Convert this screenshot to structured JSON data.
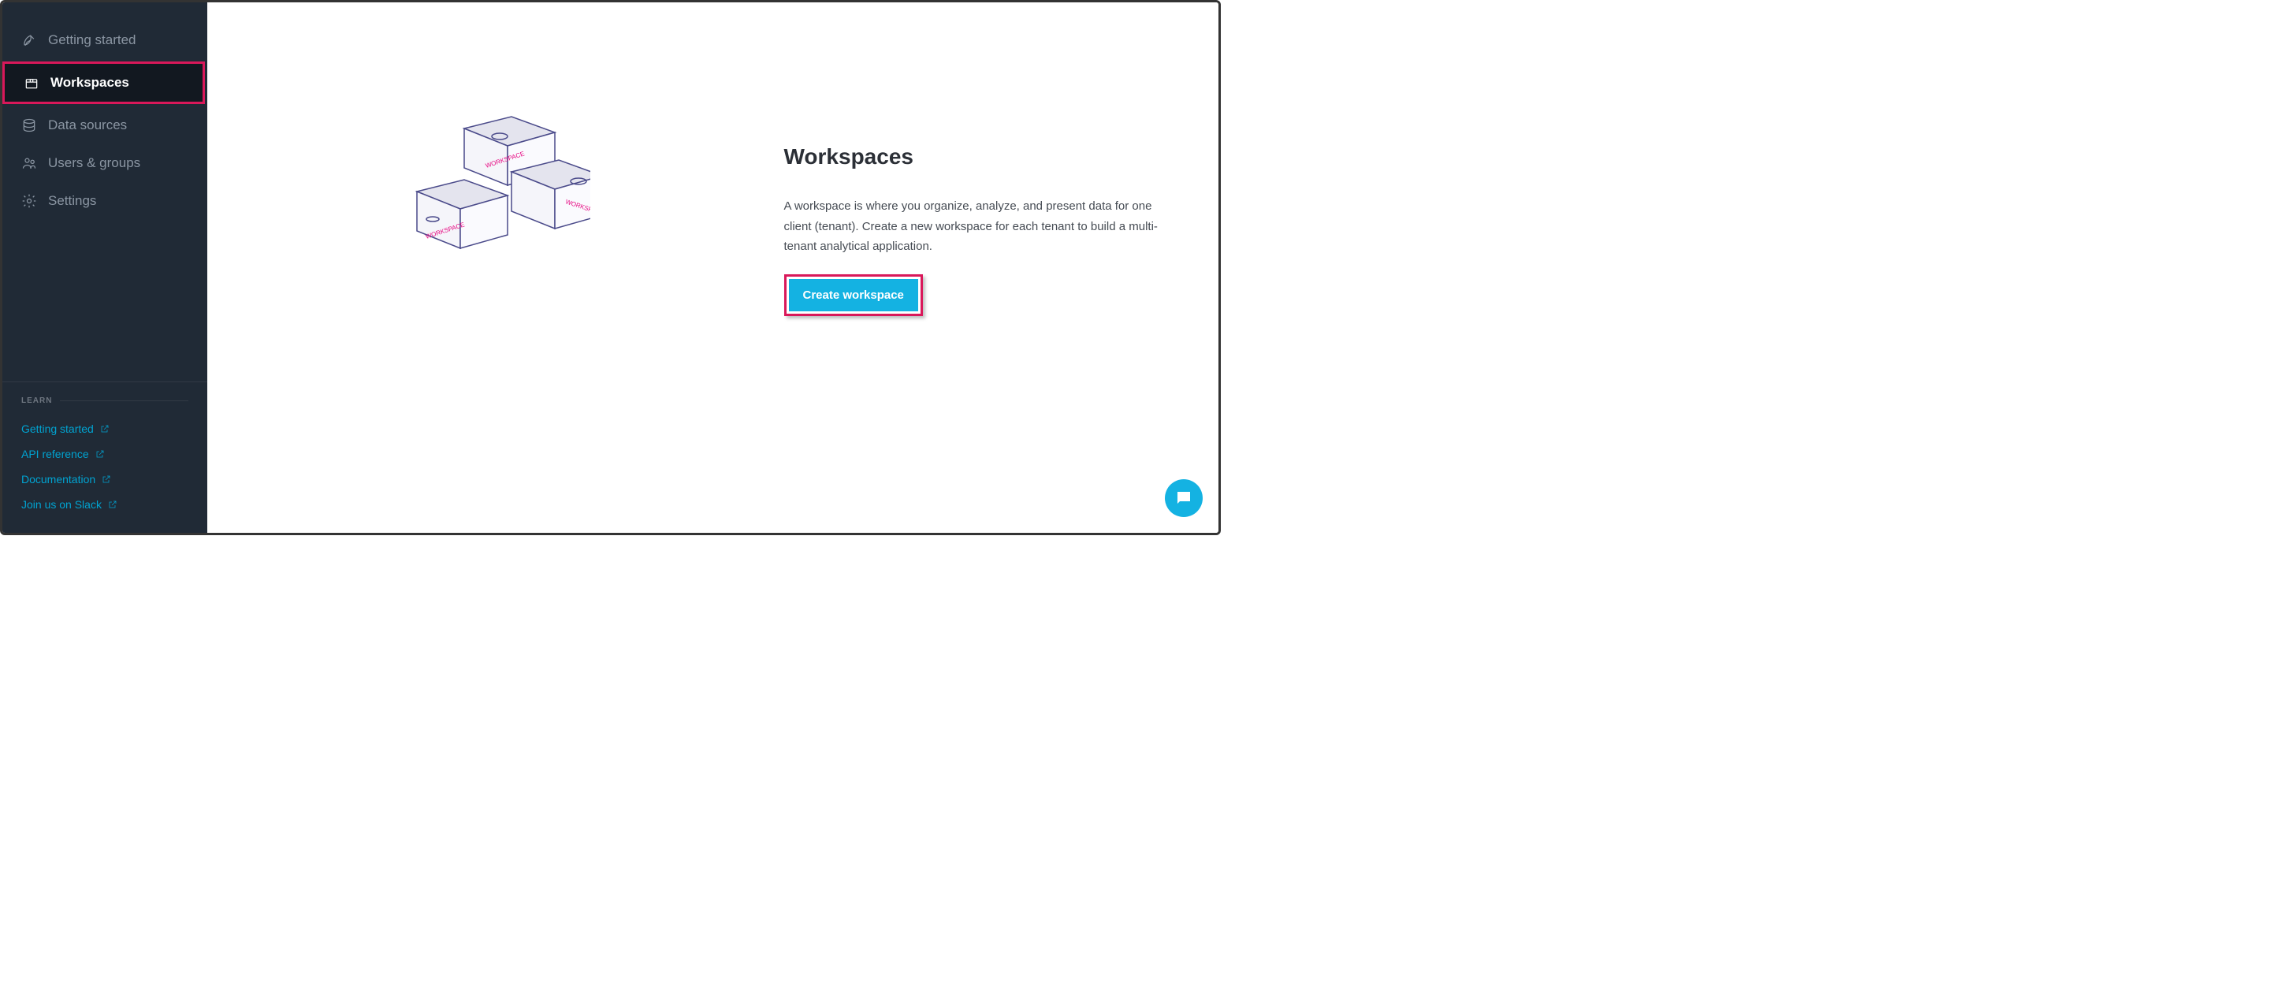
{
  "sidebar": {
    "nav": [
      {
        "label": "Getting started",
        "icon": "rocket-icon",
        "active": false
      },
      {
        "label": "Workspaces",
        "icon": "box-icon",
        "active": true
      },
      {
        "label": "Data sources",
        "icon": "database-icon",
        "active": false
      },
      {
        "label": "Users & groups",
        "icon": "users-icon",
        "active": false
      },
      {
        "label": "Settings",
        "icon": "gear-icon",
        "active": false
      }
    ],
    "learn_heading": "LEARN",
    "learn_links": [
      {
        "label": "Getting started"
      },
      {
        "label": "API reference"
      },
      {
        "label": "Documentation"
      },
      {
        "label": "Join us on Slack"
      }
    ]
  },
  "main": {
    "title": "Workspaces",
    "description": "A workspace is where you organize, analyze, and present data for one client (tenant). Create a new workspace for each tenant to build a multi-tenant analytical application.",
    "cta_label": "Create workspace",
    "illustration_label": "WORKSPACE"
  },
  "colors": {
    "accent": "#14b2e2",
    "highlight": "#D9185A",
    "sidebar_bg": "#202a36"
  }
}
